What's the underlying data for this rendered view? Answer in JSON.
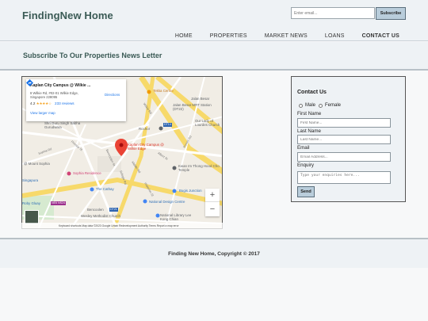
{
  "header": {
    "brand": "FindingNew Home",
    "nav": [
      "HOME",
      "PROPERTIES",
      "MARKET NEWS",
      "LOANS",
      "CONTACT US"
    ],
    "active_nav": "CONTACT US"
  },
  "newsletter": {
    "title": "Subscribe To Our Properties News Letter",
    "email_placeholder": "Enter email...",
    "button": "Subscribe"
  },
  "map": {
    "card": {
      "title": "Kaplan City Campus @ Wilkie ...",
      "address_line1": "8 Wilkie Rd, #02-01 Wilkie Edge,",
      "address_line2": "Singapore 228095",
      "rating": "4.2",
      "stars": "★★★★☆",
      "reviews": "233 reviews",
      "larger_map": "View larger map",
      "directions": "Directions"
    },
    "places": [
      "Tekka Centre",
      "Jalan Besar",
      "Jalan Besar MRT Station (DT22)",
      "Our Lady of Lourdes Church",
      "Rochor",
      "Shri Guru Singh Sabha Gurudwara",
      "Kaplan City Campus @ Wilkie Edge",
      "Kwan Im Thong Hood Cho Temple",
      "Sophia Residence",
      "@ Mount Sophia",
      "The Cathay",
      "Singapura",
      "Bugis Junction",
      "National Design Centre",
      "Bencoolen",
      "DT21",
      "Wesley Methodist Church",
      "National Library Lee Kong Chian",
      "Roby Gluay",
      "NE6 NS24",
      "DT14"
    ],
    "roads": [
      "Wilkie Rd",
      "Prinsep St",
      "Middle Rd",
      "Selegie Rd",
      "Albert St",
      "Rowell Rd",
      "Bencoolen St",
      "Sophia Rd",
      "Waterloo St"
    ],
    "zoom_in": "+",
    "zoom_out": "−",
    "attribution": "Keyboard shortcuts   Map data ©2023 Google Urban Redevelopment Authority   Terms   Report a map error"
  },
  "contact": {
    "title": "Contact Us",
    "gender_options": [
      "Male",
      "Female"
    ],
    "first_name_label": "First Name",
    "first_name_placeholder": "First Name...",
    "last_name_label": "Last Name",
    "last_name_placeholder": "Last Name...",
    "email_label": "Email",
    "email_placeholder": "Email Address...",
    "enquiry_label": "Enquiry",
    "enquiry_placeholder": "Type your enquiries here...",
    "send": "Send"
  },
  "footer": {
    "copyright": "Finding New Home, Copyright © 2017"
  },
  "colors": {
    "brand": "#3a5a55",
    "button_bg": "#b9cddb",
    "panel_bg": "#eef2f5",
    "map_pin": "#ea4335",
    "mrt_badge": "#2e64b0"
  }
}
